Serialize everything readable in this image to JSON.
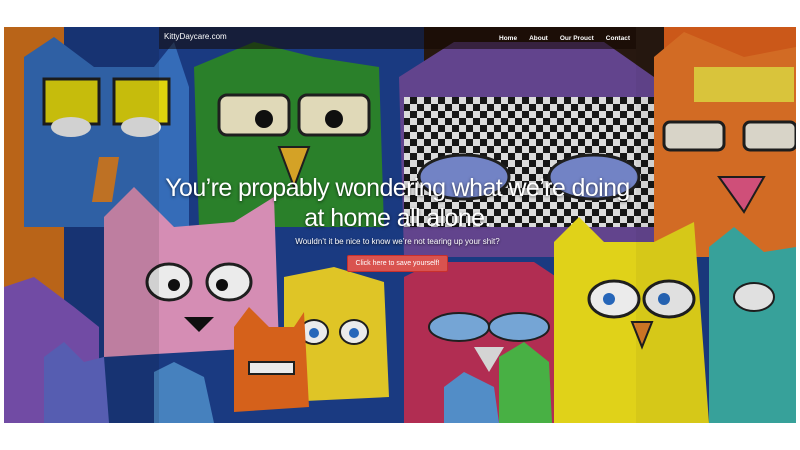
{
  "brand": "KittyDaycare.com",
  "nav": {
    "home": "Home",
    "about": "About",
    "product": "Our Prouct",
    "contact": "Contact"
  },
  "hero": {
    "headline": "You’re propably wondering what we’re doing at home all alone.",
    "subline": "Wouldn’t it be nice to know we’re not tearing up your shit?",
    "cta": "Click here to save yourself!"
  },
  "colors": {
    "cta": "#d9534f",
    "navbar": "#1a0a00"
  },
  "image": "graffiti-cat-mural"
}
